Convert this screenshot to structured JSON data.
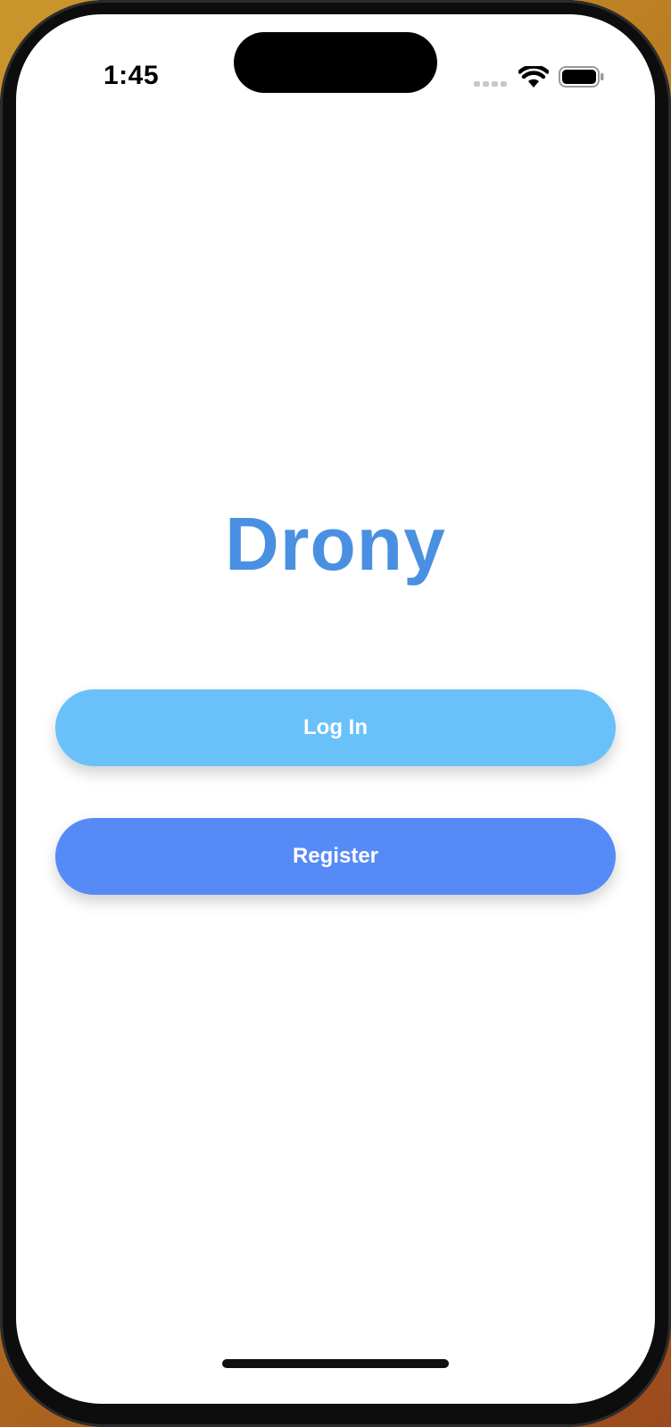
{
  "status_bar": {
    "time": "1:45",
    "icons": [
      "cellular-signal-icon",
      "wifi-icon",
      "battery-icon"
    ]
  },
  "app": {
    "title": "Drony"
  },
  "buttons": {
    "login_label": "Log In",
    "register_label": "Register"
  },
  "colors": {
    "title": "#4a90e2",
    "login_button": "#6ac1fa",
    "register_button": "#568bf7",
    "background": "#ffffff"
  }
}
